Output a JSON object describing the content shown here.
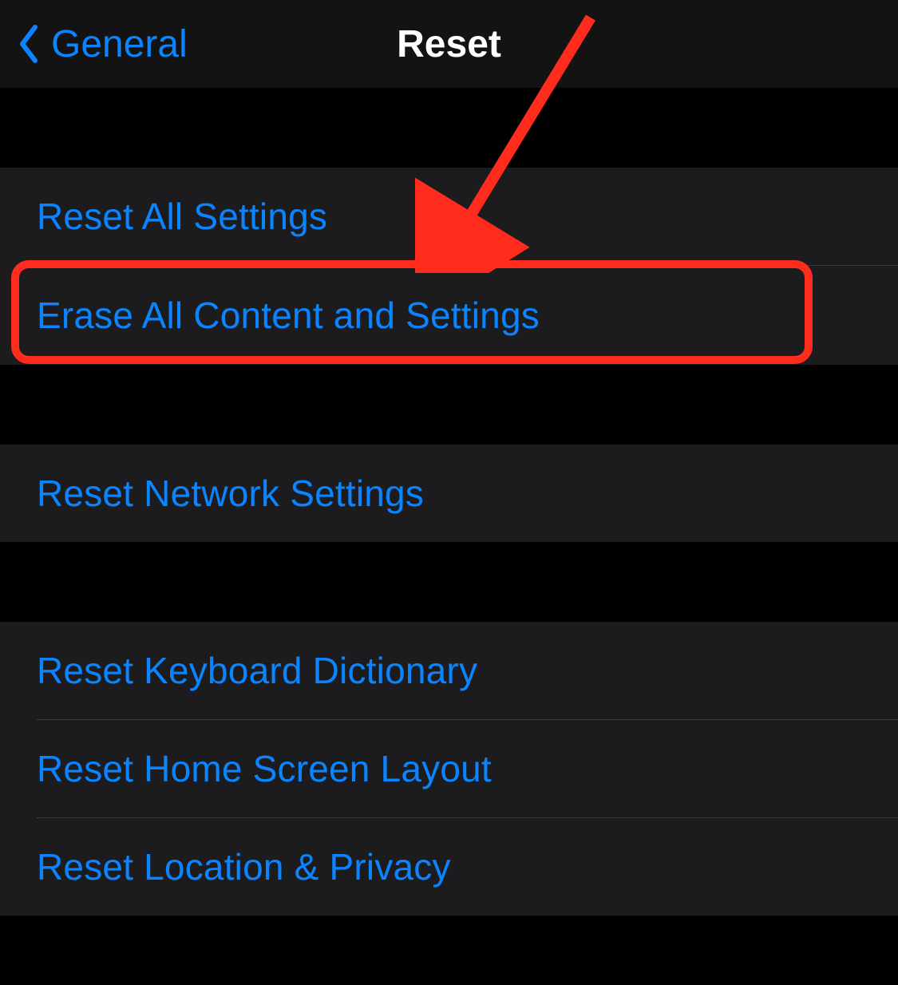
{
  "nav": {
    "back_label": "General",
    "title": "Reset"
  },
  "groups": [
    {
      "rows": [
        {
          "label": "Reset All Settings",
          "name": "reset-all-settings"
        },
        {
          "label": "Erase All Content and Settings",
          "name": "erase-all-content"
        }
      ]
    },
    {
      "rows": [
        {
          "label": "Reset Network Settings",
          "name": "reset-network-settings"
        }
      ]
    },
    {
      "rows": [
        {
          "label": "Reset Keyboard Dictionary",
          "name": "reset-keyboard-dictionary"
        },
        {
          "label": "Reset Home Screen Layout",
          "name": "reset-home-screen-layout"
        },
        {
          "label": "Reset Location & Privacy",
          "name": "reset-location-privacy"
        }
      ]
    }
  ],
  "annotation": {
    "highlighted_row": "erase-all-content",
    "color": "#ff2b1c"
  }
}
